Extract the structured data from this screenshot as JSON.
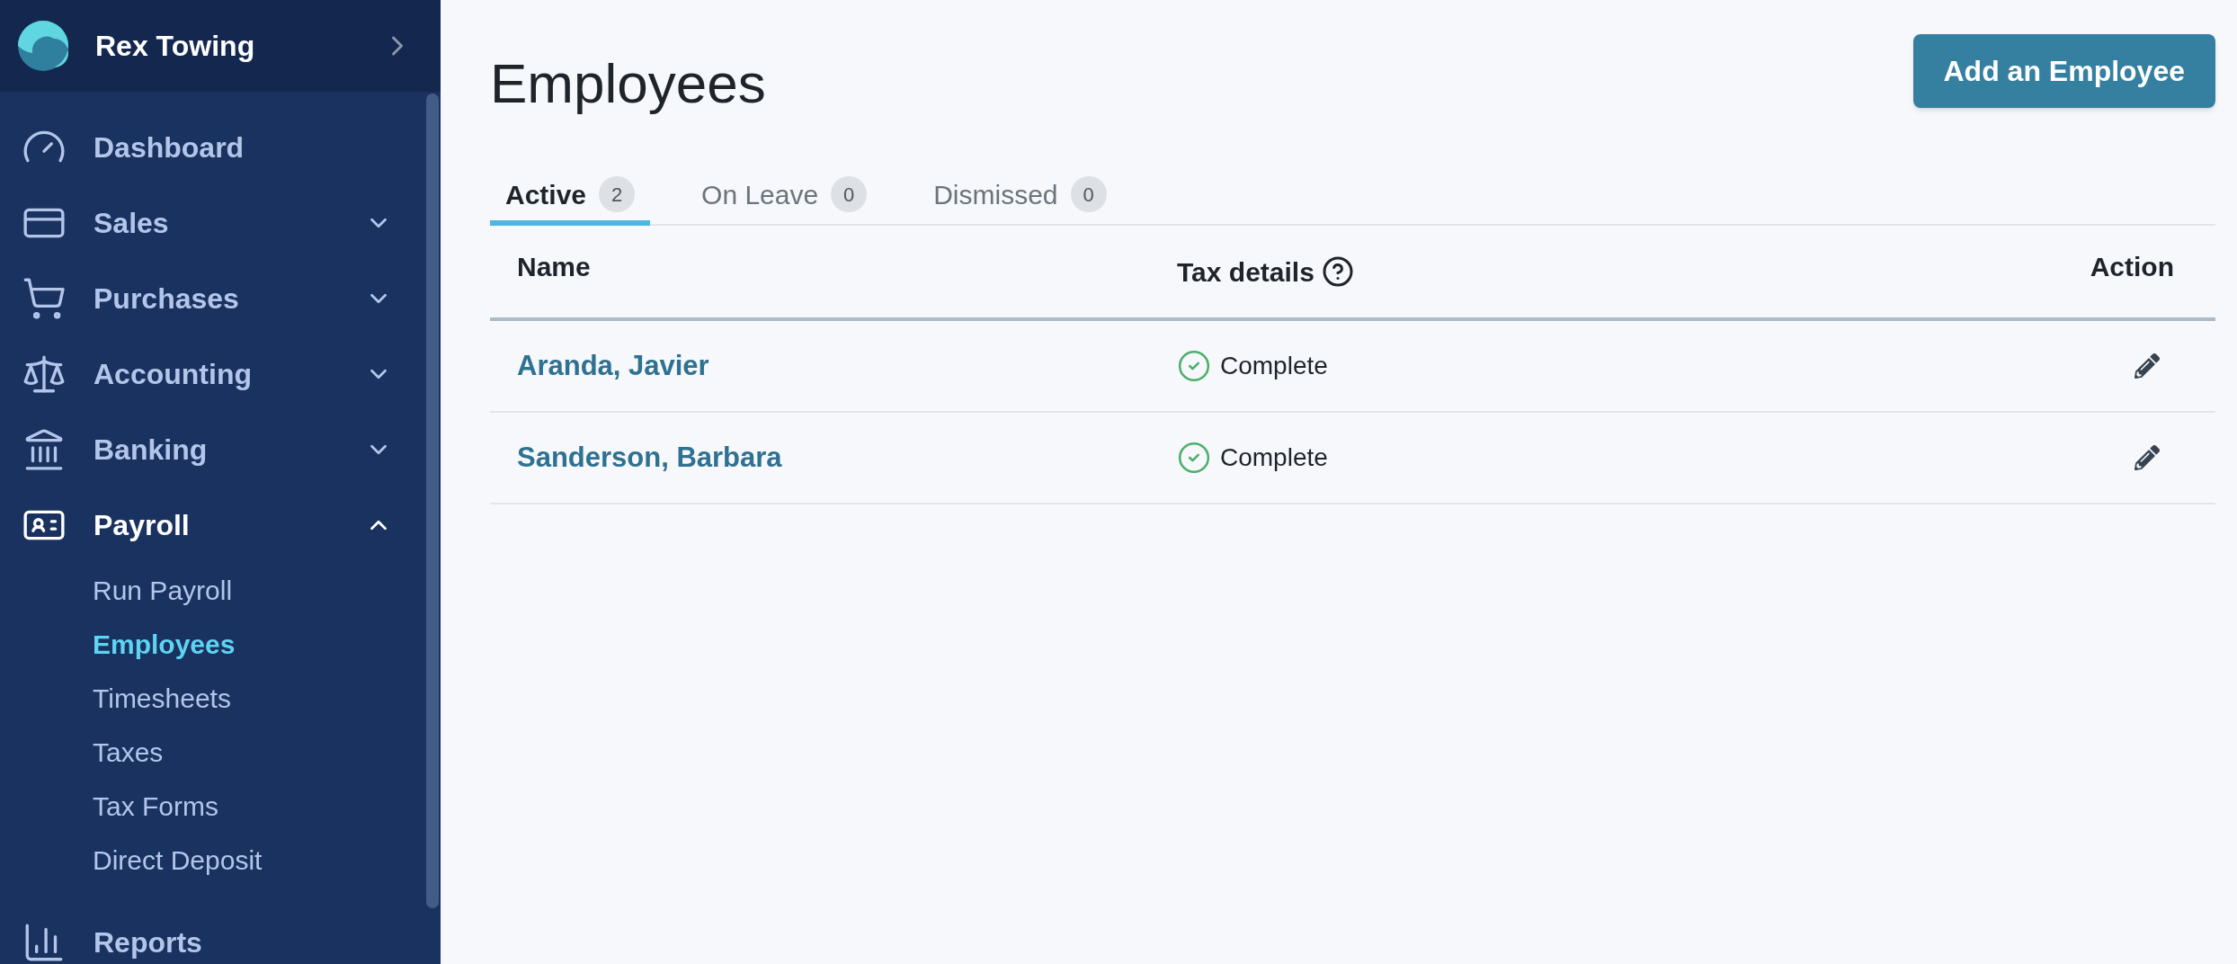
{
  "sidebar": {
    "company": "Rex Towing",
    "items": [
      {
        "label": "Dashboard",
        "kind": "link"
      },
      {
        "label": "Sales",
        "kind": "group",
        "expanded": false
      },
      {
        "label": "Purchases",
        "kind": "group",
        "expanded": false
      },
      {
        "label": "Accounting",
        "kind": "group",
        "expanded": false
      },
      {
        "label": "Banking",
        "kind": "group",
        "expanded": false
      },
      {
        "label": "Payroll",
        "kind": "group",
        "expanded": true,
        "children": [
          {
            "label": "Run Payroll",
            "selected": false
          },
          {
            "label": "Employees",
            "selected": true
          },
          {
            "label": "Timesheets",
            "selected": false
          },
          {
            "label": "Taxes",
            "selected": false
          },
          {
            "label": "Tax Forms",
            "selected": false
          },
          {
            "label": "Direct Deposit",
            "selected": false
          }
        ]
      },
      {
        "label": "Reports",
        "kind": "link"
      }
    ]
  },
  "page": {
    "title": "Employees",
    "add_button": "Add an Employee"
  },
  "tabs": [
    {
      "label": "Active",
      "count": "2",
      "selected": true
    },
    {
      "label": "On Leave",
      "count": "0",
      "selected": false
    },
    {
      "label": "Dismissed",
      "count": "0",
      "selected": false
    }
  ],
  "table": {
    "columns": [
      "Name",
      "Tax details",
      "Action"
    ],
    "rows": [
      {
        "name": "Aranda, Javier",
        "tax_details": "Complete"
      },
      {
        "name": "Sanderson, Barbara",
        "tax_details": "Complete"
      }
    ]
  }
}
